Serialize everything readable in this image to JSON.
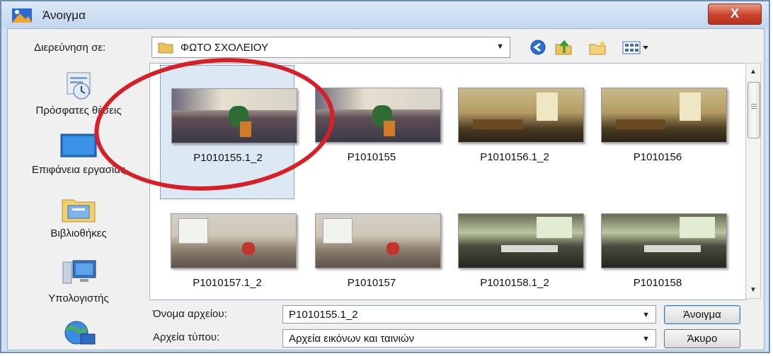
{
  "window": {
    "title": "Άνοιγμα",
    "close_label": "X"
  },
  "toolbar": {
    "look_in_label": "Διερεύνηση σε:",
    "look_in_value": "ΦΩΤΟ ΣΧΟΛΕΙΟΥ",
    "back_icon": "back-icon",
    "up_icon": "up-folder-icon",
    "new_folder_icon": "new-folder-icon",
    "views_icon": "views-menu-icon"
  },
  "places": [
    {
      "label": "Πρόσφατες θέσεις",
      "icon": "recent-places-icon"
    },
    {
      "label": "Επιφάνεια εργασίας",
      "icon": "desktop-icon"
    },
    {
      "label": "Βιβλιοθήκες",
      "icon": "libraries-icon"
    },
    {
      "label": "Υπολογιστής",
      "icon": "computer-icon"
    },
    {
      "label": "",
      "icon": "network-icon"
    }
  ],
  "files": [
    {
      "name": "P1010155.1_2",
      "selected": true
    },
    {
      "name": "P1010155"
    },
    {
      "name": "P1010156.1_2"
    },
    {
      "name": "P1010156"
    },
    {
      "name": "P1010157.1_2"
    },
    {
      "name": "P1010157"
    },
    {
      "name": "P1010158.1_2"
    },
    {
      "name": "P1010158"
    }
  ],
  "filename": {
    "label": "Όνομα αρχείου:",
    "value": "P1010155.1_2"
  },
  "filetype": {
    "label": "Αρχεία τύπου:",
    "value": "Αρχεία εικόνων και ταινιών"
  },
  "buttons": {
    "open": "Άνοιγμα",
    "cancel": "Άκυρο"
  },
  "colors": {
    "annotation": "#d81f28",
    "accent": "#3c7fb1"
  }
}
